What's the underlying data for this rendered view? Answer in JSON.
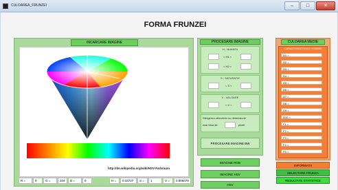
{
  "window": {
    "title": "CULOAREA_FRUNZEI"
  },
  "page": {
    "title": "FORMA FRUNZEI"
  },
  "left_panel": {
    "load_button": "INCARCARE IMAGINE",
    "image_credit": "http://de.wikipedia.org/wiki/HSV-Farbraum",
    "readouts": [
      "R =",
      "0",
      "G =",
      "204",
      "B =",
      "0",
      "H =",
      "0.33727",
      "S =",
      "1",
      "V =",
      "0.806079"
    ]
  },
  "processing": {
    "header": "PROCESARE IMAGINE",
    "hue": {
      "title": "H - NUANTA",
      "labels": [
        "< H1 <",
        "< H2 <"
      ]
    },
    "sat": {
      "title": "S - SATURATIE",
      "label": "< S <"
    },
    "val": {
      "title": "V - VALOARE",
      "label": "< V <"
    },
    "cleanup": {
      "text1": "Stergerea obiectelor cu dimensiune",
      "text2": "mai mica de",
      "unit": "pixeli"
    },
    "bw_button": "PROCESARE IMAGINE BW",
    "rgb_button": "IMAGINE RGB",
    "hsv_image_button": "IMAGINE HSV",
    "hsv_button": "HSV"
  },
  "avg_color": {
    "header": "CULOAREA MEDIE",
    "features_title": "CARACTERISTICILE FORMEI",
    "features": [
      "D1 =",
      "D2 =",
      "D3 =",
      "D4 =",
      "D5 =",
      "D6 =",
      "D7 =",
      "D8 =",
      "D9 =",
      "D10 =",
      "F1 =",
      "F2 =",
      "F3 =",
      "F4 =",
      "F5 ="
    ]
  },
  "buttons": {
    "info": "INFORMATII",
    "select": "SELECTARE FRUNZA",
    "stats": "REZULTATE STATISTICE"
  },
  "colors": {
    "green_panel": "#a9d99b",
    "green_button": "#6ecf61",
    "orange_panel": "#f1a774",
    "orange_box": "#f47e36"
  }
}
